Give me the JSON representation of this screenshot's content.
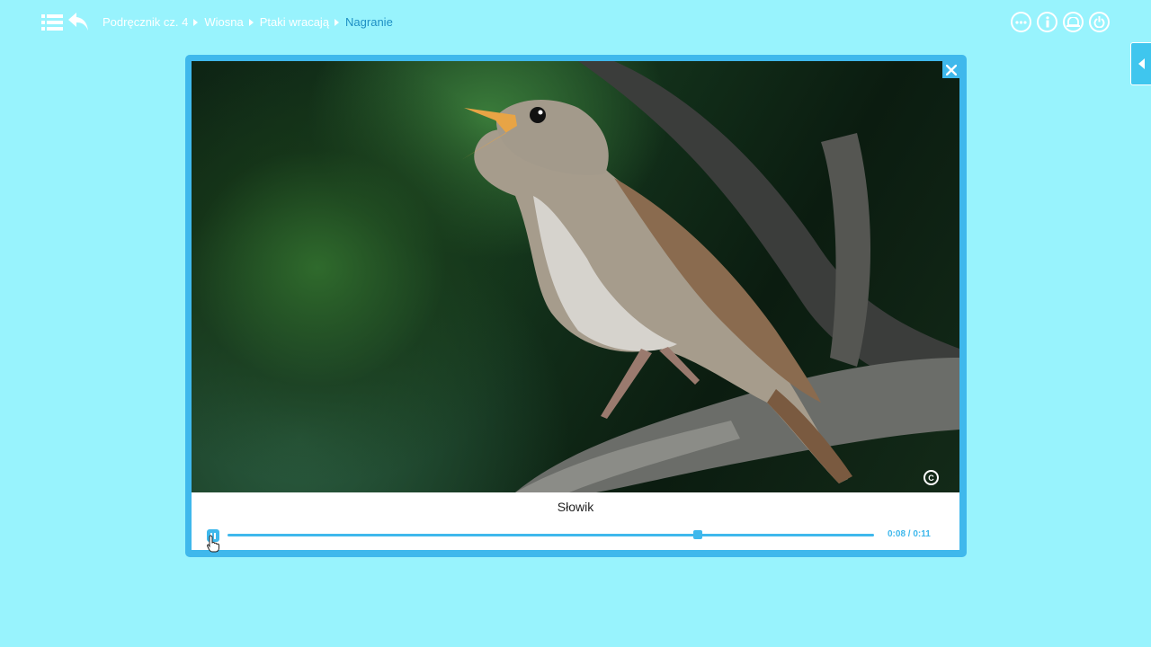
{
  "breadcrumb": {
    "items": [
      "Podręcznik cz. 4",
      "Wiosna",
      "Ptaki wracają",
      "Nagranie"
    ]
  },
  "header": {
    "icons": [
      "menu-icon",
      "back-icon",
      "more-icon",
      "info-icon",
      "display-icon",
      "power-icon"
    ]
  },
  "player": {
    "caption": "Słowik",
    "time": "0:08 / 0:11",
    "progress_fraction": 0.7273,
    "copyright_mark": "C",
    "state": "playing"
  },
  "colors": {
    "background": "#98f3fd",
    "accent": "#3fb8ec",
    "current_crumb": "#1e8fc4"
  }
}
